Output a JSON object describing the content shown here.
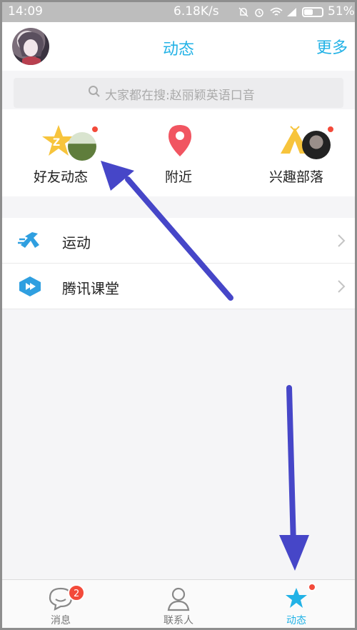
{
  "status_bar": {
    "time": "14:09",
    "speed": "6.18K/s",
    "battery": "51%"
  },
  "header": {
    "title": "动态",
    "more_label": "更多"
  },
  "search": {
    "placeholder": "大家都在搜:赵丽颖英语口音"
  },
  "quick_entries": [
    {
      "label": "好友动态",
      "icon": "friend-feed-star-icon",
      "has_dot": true
    },
    {
      "label": "附近",
      "icon": "location-pin-icon",
      "has_dot": false
    },
    {
      "label": "兴趣部落",
      "icon": "tribe-tent-icon",
      "has_dot": true
    }
  ],
  "list": [
    {
      "label": "运动",
      "icon": "running-icon"
    },
    {
      "label": "腾讯课堂",
      "icon": "tencent-classroom-icon"
    }
  ],
  "tabbar": [
    {
      "label": "消息",
      "icon": "chat-bubble-icon",
      "badge": "2",
      "active": false
    },
    {
      "label": "联系人",
      "icon": "contact-person-icon",
      "active": false
    },
    {
      "label": "动态",
      "icon": "star-feed-icon",
      "active": true
    }
  ],
  "colors": {
    "accent": "#22b2e6",
    "badge": "#f34a3a",
    "annotation_arrow": "#4646c8"
  }
}
